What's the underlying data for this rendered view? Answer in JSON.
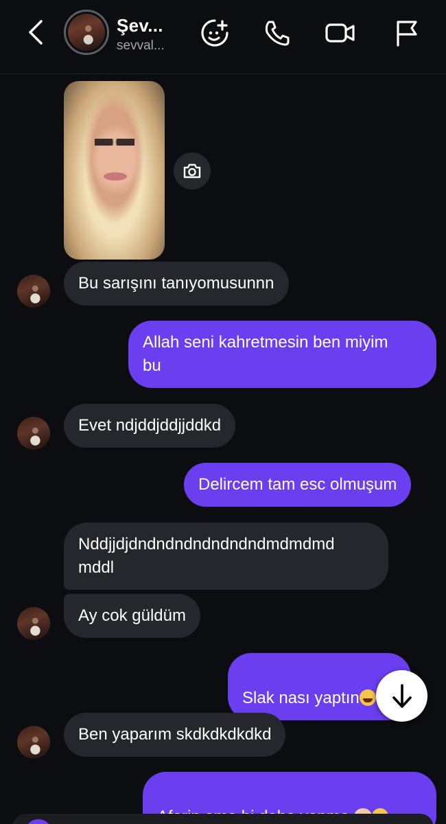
{
  "header": {
    "name": "Şev...",
    "handle": "sevval...",
    "icons": [
      "back-chevron-icon",
      "sticker-icon",
      "phone-icon",
      "video-icon",
      "flag-icon"
    ]
  },
  "photo": {
    "icon": "camera-icon"
  },
  "messages": [
    {
      "dir": "in",
      "text": "Bu sarışını tanıyomusunnn"
    },
    {
      "dir": "out",
      "text": "Allah seni kahretmesin ben miyim\nbu"
    },
    {
      "dir": "in",
      "text": "Evet ndjddjddjjddkd"
    },
    {
      "dir": "out",
      "text": "Delircem tam esc olmuşum"
    },
    {
      "dir": "in",
      "text": "Nddjjdjdndndndndndndndmdmdmd\nmddl"
    },
    {
      "dir": "in",
      "text": "Ay cok güldüm"
    },
    {
      "dir": "out",
      "text": "Slak nası yaptın"
    },
    {
      "dir": "in",
      "text": "Ben yaparım skdkdkdkdkd"
    },
    {
      "dir": "out",
      "text": "Aferin ama bi daha yapma"
    }
  ],
  "scroll_button": {
    "icon": "arrow-down-icon"
  },
  "colors": {
    "outgoing": "#6b3ff0",
    "incoming": "#26272c",
    "background": "#0c0d10"
  }
}
